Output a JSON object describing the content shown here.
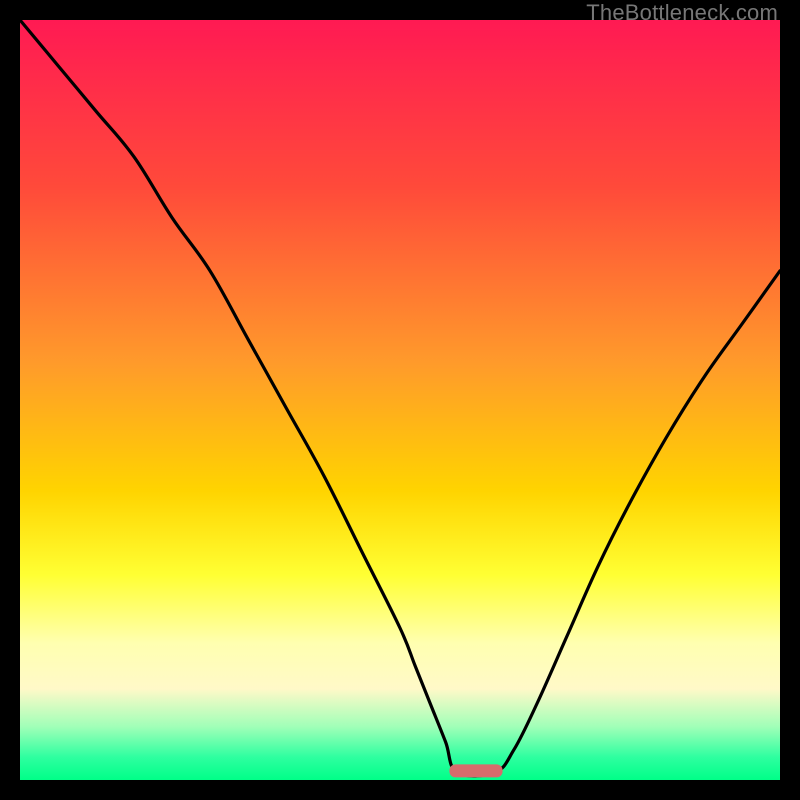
{
  "watermark": "TheBottleneck.com",
  "chart_data": {
    "type": "line",
    "title": "",
    "xlabel": "",
    "ylabel": "",
    "xlim": [
      0,
      100
    ],
    "ylim": [
      0,
      100
    ],
    "background_gradient_stops": [
      {
        "offset": 0,
        "color": "#ff1a53"
      },
      {
        "offset": 22,
        "color": "#ff4a3a"
      },
      {
        "offset": 45,
        "color": "#ff9a2b"
      },
      {
        "offset": 62,
        "color": "#ffd400"
      },
      {
        "offset": 73,
        "color": "#ffff33"
      },
      {
        "offset": 82,
        "color": "#ffffb0"
      },
      {
        "offset": 88,
        "color": "#fff9c8"
      },
      {
        "offset": 93,
        "color": "#a0ffb8"
      },
      {
        "offset": 97,
        "color": "#2effa0"
      },
      {
        "offset": 100,
        "color": "#00ff88"
      }
    ],
    "series": [
      {
        "name": "bottleneck-curve",
        "x": [
          0,
          5,
          10,
          15,
          20,
          25,
          30,
          35,
          40,
          45,
          50,
          52,
          54,
          56,
          57.5,
          62.5,
          65,
          68,
          72,
          76,
          80,
          85,
          90,
          95,
          100
        ],
        "y": [
          100,
          94,
          88,
          82,
          74,
          67,
          58,
          49,
          40,
          30,
          20,
          15,
          10,
          5,
          1,
          1,
          4,
          10,
          19,
          28,
          36,
          45,
          53,
          60,
          67
        ]
      }
    ],
    "marker": {
      "name": "optimal-range",
      "x_start": 56.5,
      "x_end": 63.5,
      "y": 1.2,
      "color": "#d66c6c"
    }
  }
}
